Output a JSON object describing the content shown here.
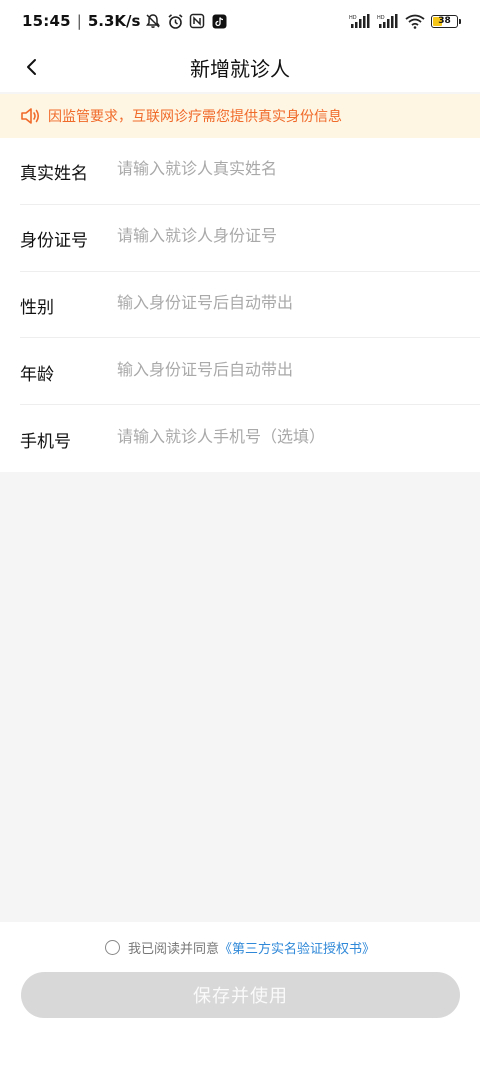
{
  "status_bar": {
    "time": "15:45",
    "separator": "|",
    "net_speed": "5.3K/s",
    "icons": [
      "mute-bell-icon",
      "alarm-icon",
      "nfc-icon",
      "tiktok-icon",
      "signal-hd-icon",
      "signal-hd-icon",
      "wifi-icon",
      "battery-icon"
    ],
    "battery_level": "38"
  },
  "nav": {
    "back_icon": "chevron-left-icon",
    "title": "新增就诊人"
  },
  "notice": {
    "icon": "speaker-icon",
    "text": "因监管要求，互联网诊疗需您提供真实身份信息",
    "color": "#f06a2a"
  },
  "form": {
    "fields": [
      {
        "label": "真实姓名",
        "placeholder": "请输入就诊人真实姓名"
      },
      {
        "label": "身份证号",
        "placeholder": "请输入就诊人身份证号"
      },
      {
        "label": "性别",
        "placeholder": "输入身份证号后自动带出"
      },
      {
        "label": "年龄",
        "placeholder": "输入身份证号后自动带出"
      },
      {
        "label": "手机号",
        "placeholder": "请输入就诊人手机号（选填）"
      }
    ]
  },
  "bottom": {
    "agree_text": "我已阅读并同意",
    "agree_link": "《第三方实名验证授权书》",
    "save_label": "保存并使用"
  }
}
